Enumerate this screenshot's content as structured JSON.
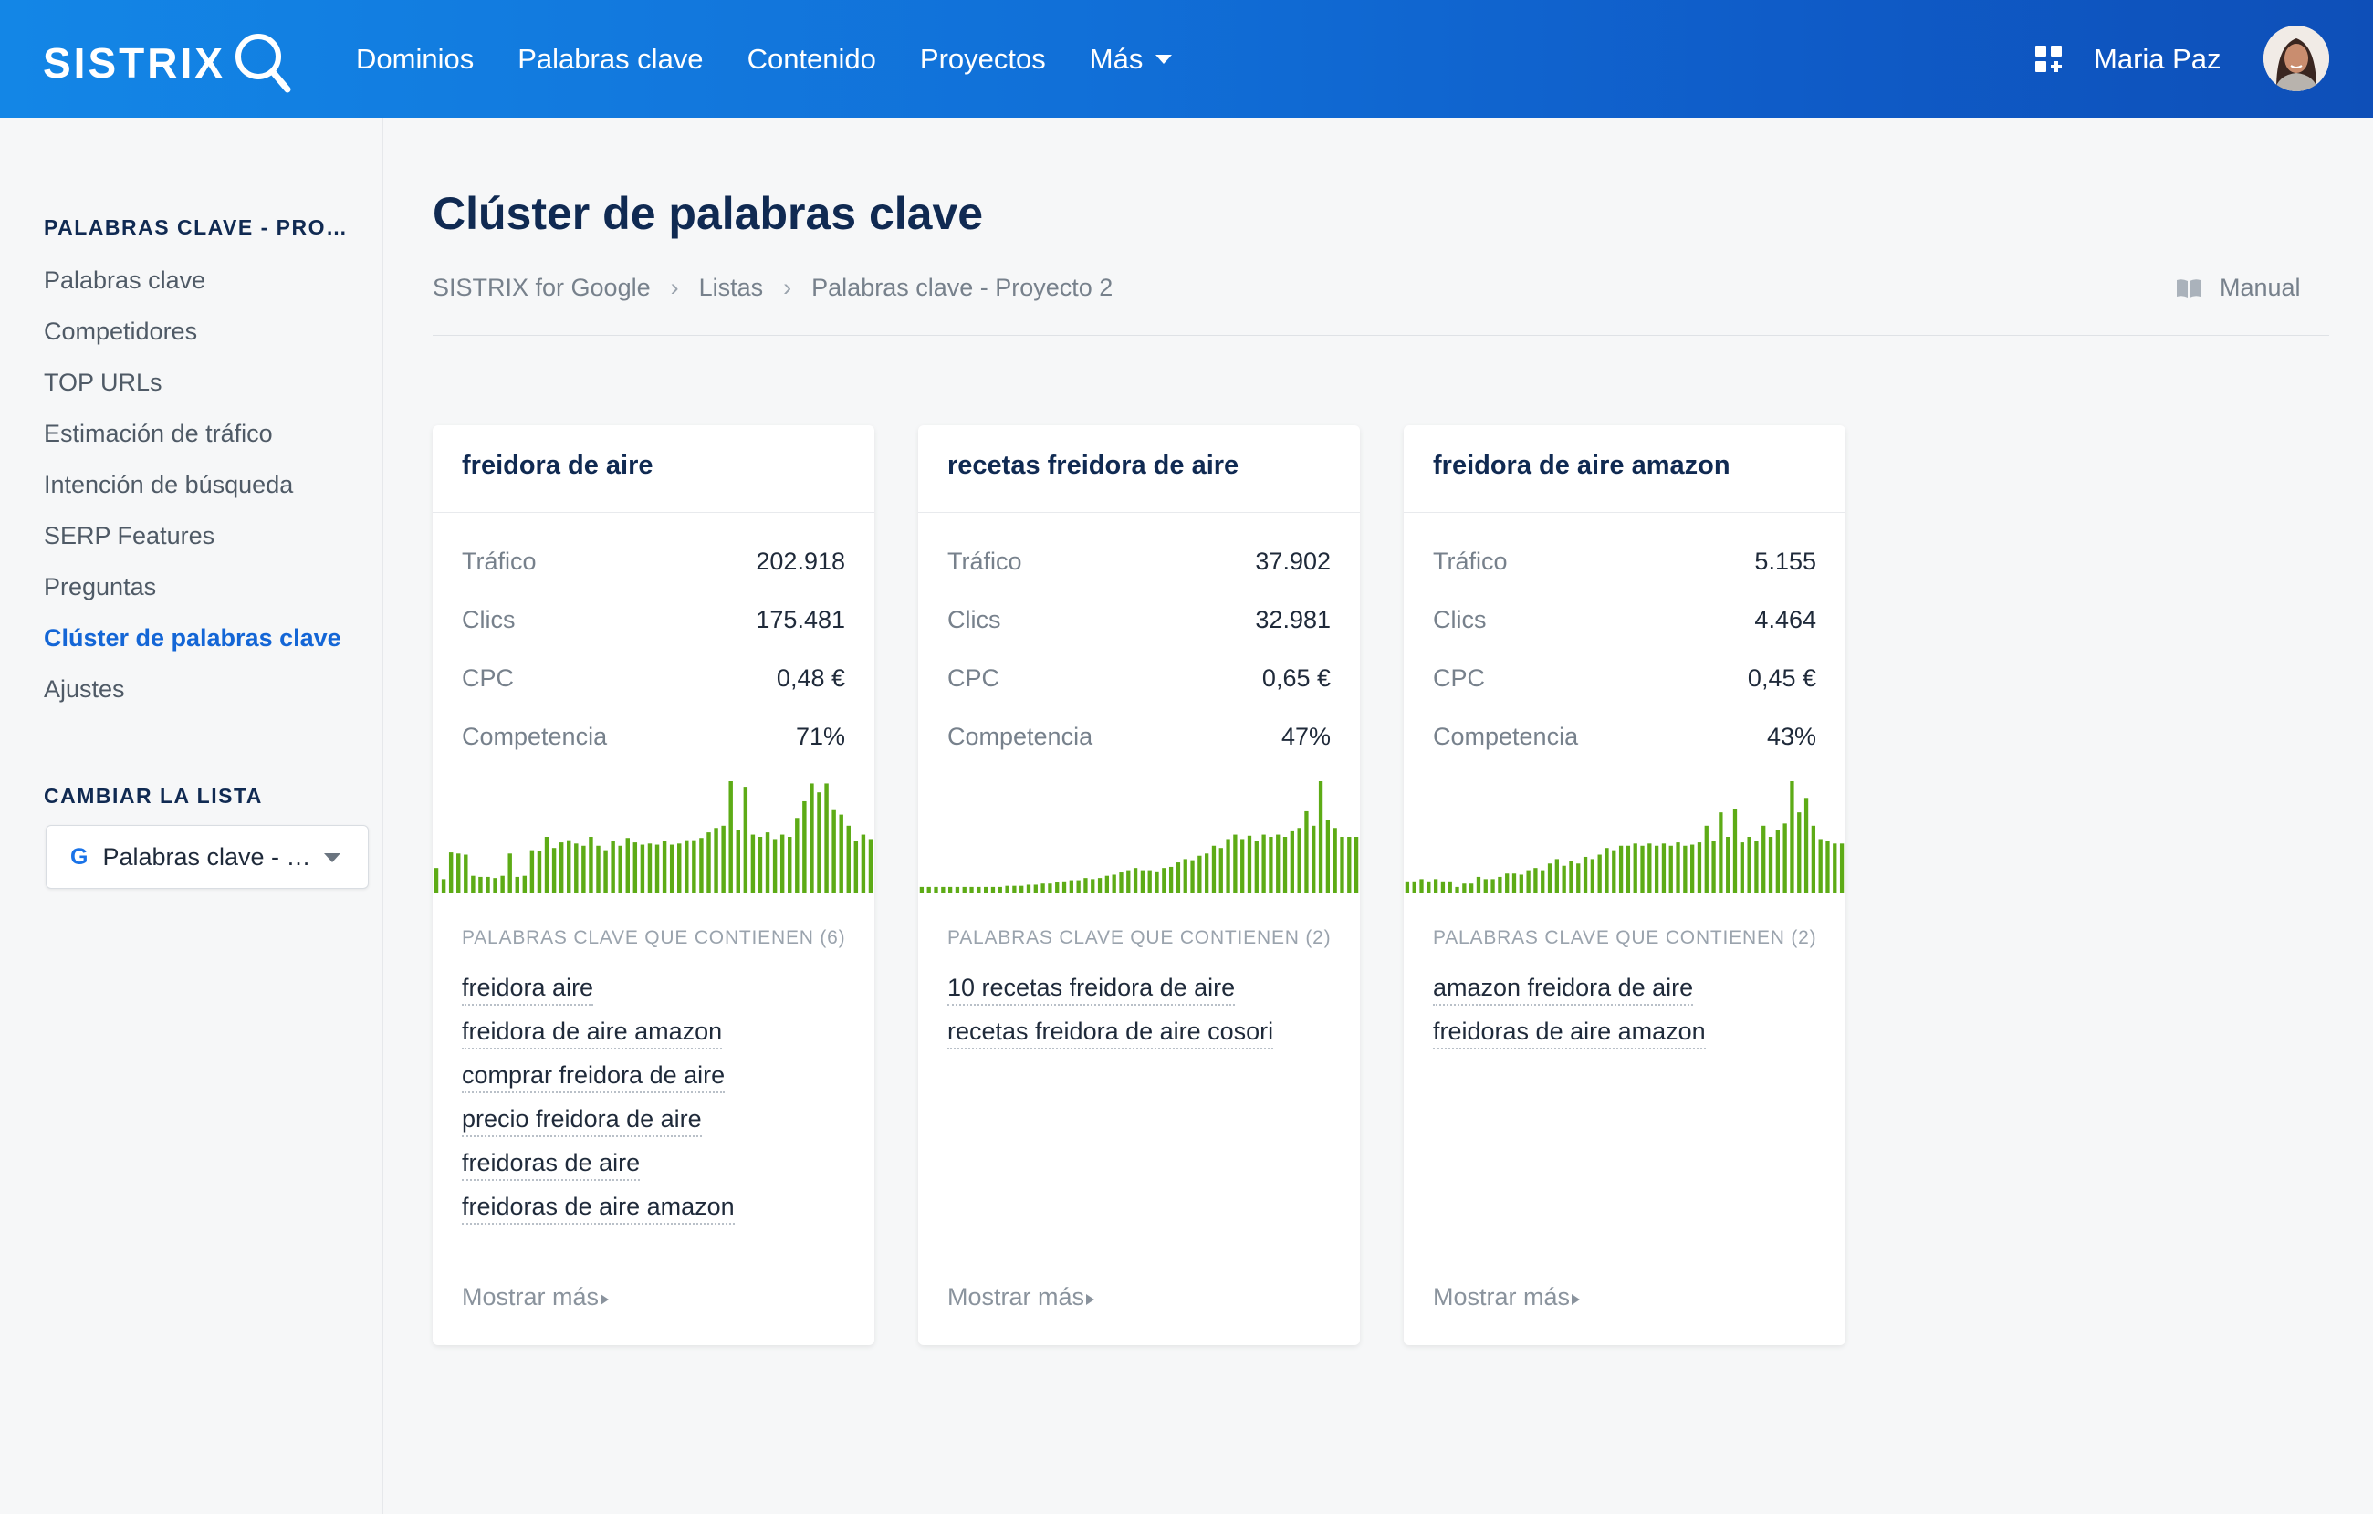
{
  "header": {
    "logo": "SISTRIX",
    "nav": [
      "Dominios",
      "Palabras clave",
      "Contenido",
      "Proyectos",
      "Más"
    ],
    "user": "Maria Paz"
  },
  "sidebar": {
    "section_title": "PALABRAS CLAVE - PRO…",
    "items": [
      {
        "label": "Palabras clave",
        "active": false
      },
      {
        "label": "Competidores",
        "active": false
      },
      {
        "label": "TOP URLs",
        "active": false
      },
      {
        "label": "Estimación de tráfico",
        "active": false
      },
      {
        "label": "Intención de búsqueda",
        "active": false
      },
      {
        "label": "SERP Features",
        "active": false
      },
      {
        "label": "Preguntas",
        "active": false
      },
      {
        "label": "Clúster de palabras clave",
        "active": true
      },
      {
        "label": "Ajustes",
        "active": false
      }
    ],
    "change_list_title": "CAMBIAR LA LISTA",
    "list_select": {
      "icon": "G",
      "value": "Palabras clave - …"
    }
  },
  "main": {
    "title": "Clúster de palabras clave",
    "breadcrumb": [
      "SISTRIX for Google",
      "Listas",
      "Palabras clave - Proyecto 2"
    ],
    "manual_label": "Manual"
  },
  "colors": {
    "header_start": "#1386e6",
    "header_end": "#0e4fb8",
    "accent": "#1466d6",
    "title": "#102a52",
    "bars": "#5dab16"
  },
  "cards": [
    {
      "title": "freidora de aire",
      "metrics": [
        {
          "label": "Tráfico",
          "value": "202.918"
        },
        {
          "label": "Clics",
          "value": "175.481"
        },
        {
          "label": "CPC",
          "value": "0,48 €"
        },
        {
          "label": "Competencia",
          "value": "71%"
        }
      ],
      "trend": [
        0.22,
        0.12,
        0.36,
        0.35,
        0.34,
        0.15,
        0.14,
        0.14,
        0.13,
        0.15,
        0.35,
        0.14,
        0.15,
        0.38,
        0.37,
        0.5,
        0.4,
        0.45,
        0.47,
        0.44,
        0.42,
        0.5,
        0.42,
        0.38,
        0.46,
        0.42,
        0.49,
        0.45,
        0.43,
        0.44,
        0.43,
        0.46,
        0.43,
        0.44,
        0.47,
        0.47,
        0.49,
        0.54,
        0.58,
        0.6,
        1.0,
        0.56,
        0.95,
        0.52,
        0.5,
        0.54,
        0.48,
        0.52,
        0.5,
        0.67,
        0.82,
        0.98,
        0.9,
        0.98,
        0.74,
        0.7,
        0.6,
        0.46,
        0.52,
        0.48
      ],
      "kw_heading": "PALABRAS CLAVE QUE CONTIENEN (6)",
      "keywords": [
        "freidora aire",
        "freidora de aire amazon",
        "comprar freidora de aire",
        "precio freidora de aire",
        "freidoras de aire",
        "freidoras de aire amazon"
      ],
      "show_more": "Mostrar más"
    },
    {
      "title": "recetas freidora de aire",
      "metrics": [
        {
          "label": "Tráfico",
          "value": "37.902"
        },
        {
          "label": "Clics",
          "value": "32.981"
        },
        {
          "label": "CPC",
          "value": "0,65 €"
        },
        {
          "label": "Competencia",
          "value": "47%"
        }
      ],
      "trend": [
        0.05,
        0.05,
        0.05,
        0.05,
        0.05,
        0.05,
        0.05,
        0.05,
        0.05,
        0.05,
        0.05,
        0.05,
        0.06,
        0.06,
        0.06,
        0.07,
        0.07,
        0.08,
        0.08,
        0.09,
        0.1,
        0.11,
        0.11,
        0.13,
        0.12,
        0.13,
        0.15,
        0.16,
        0.18,
        0.2,
        0.22,
        0.2,
        0.2,
        0.19,
        0.22,
        0.23,
        0.27,
        0.3,
        0.29,
        0.33,
        0.35,
        0.42,
        0.4,
        0.48,
        0.52,
        0.48,
        0.51,
        0.46,
        0.52,
        0.5,
        0.52,
        0.5,
        0.55,
        0.58,
        0.73,
        0.6,
        1.0,
        0.65,
        0.58,
        0.5,
        0.5,
        0.5
      ],
      "kw_heading": "PALABRAS CLAVE QUE CONTIENEN (2)",
      "keywords": [
        "10 recetas freidora de aire",
        "recetas freidora de aire cosori"
      ],
      "show_more": "Mostrar más"
    },
    {
      "title": "freidora de aire amazon",
      "metrics": [
        {
          "label": "Tráfico",
          "value": "5.155"
        },
        {
          "label": "Clics",
          "value": "4.464"
        },
        {
          "label": "CPC",
          "value": "0,45 €"
        },
        {
          "label": "Competencia",
          "value": "43%"
        }
      ],
      "trend": [
        0.1,
        0.1,
        0.12,
        0.1,
        0.12,
        0.1,
        0.1,
        0.05,
        0.08,
        0.08,
        0.14,
        0.12,
        0.12,
        0.14,
        0.17,
        0.17,
        0.16,
        0.2,
        0.22,
        0.2,
        0.26,
        0.3,
        0.24,
        0.28,
        0.26,
        0.32,
        0.3,
        0.34,
        0.4,
        0.38,
        0.42,
        0.42,
        0.44,
        0.42,
        0.44,
        0.42,
        0.44,
        0.42,
        0.45,
        0.42,
        0.43,
        0.45,
        0.6,
        0.46,
        0.72,
        0.5,
        0.75,
        0.45,
        0.5,
        0.46,
        0.6,
        0.5,
        0.56,
        0.62,
        1.0,
        0.72,
        0.85,
        0.6,
        0.48,
        0.46,
        0.44,
        0.44
      ],
      "kw_heading": "PALABRAS CLAVE QUE CONTIENEN (2)",
      "keywords": [
        "amazon freidora de aire",
        "freidoras de aire amazon"
      ],
      "show_more": "Mostrar más"
    }
  ]
}
